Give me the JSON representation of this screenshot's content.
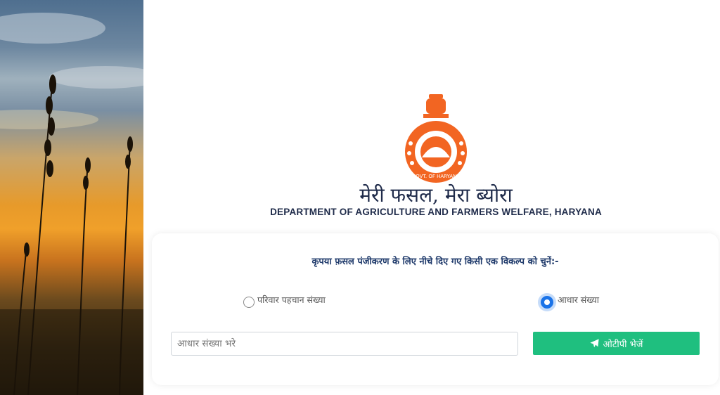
{
  "header": {
    "title_hi": "मेरी फसल, मेरा ब्योरा",
    "department": "DEPARTMENT OF AGRICULTURE AND FARMERS WELFARE, HARYANA",
    "emblem_text": "GOVT. OF HARYANA"
  },
  "form": {
    "instruction": "कृपया फ़सल पंजीकरण के लिए नीचे दिए गए किसी एक विकल्प को चुनें:-",
    "options": [
      {
        "label": "परिवार पहचान संख्या",
        "selected": false
      },
      {
        "label": "आधार संख्या",
        "selected": true
      }
    ],
    "input_placeholder": "आधार संख्या भरे",
    "input_value": "",
    "submit_label": "ओटीपी भेजें",
    "submit_icon": "paper-plane-icon"
  },
  "colors": {
    "emblem": "#f26522",
    "title": "#1f2b4a",
    "button": "#1fbf7f",
    "radio_selected": "#1a73e8"
  }
}
